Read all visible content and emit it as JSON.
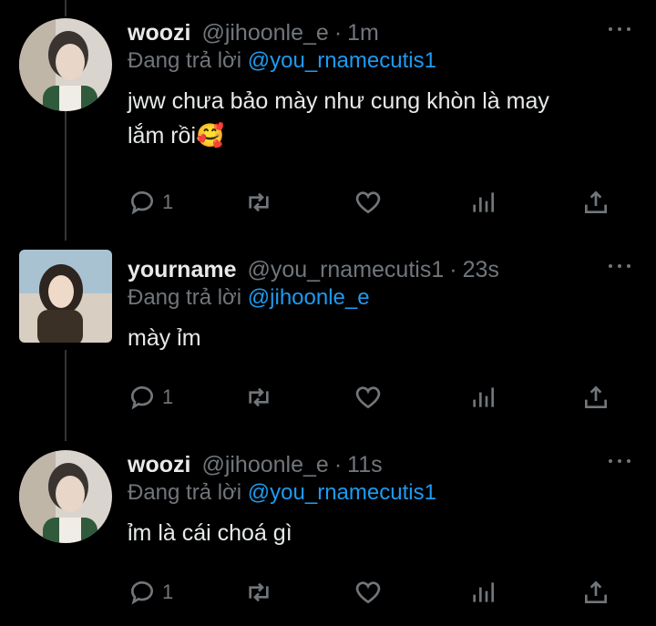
{
  "tweets": [
    {
      "name": "woozi",
      "handle": "@jihoonle_e",
      "dot": "·",
      "time": "1m",
      "reply_prefix": "Đang trả lời",
      "reply_to": "@you_rnamecutis1",
      "text_line1": "jww chưa bảo mày như cung khòn là may",
      "text_line2": "lắm rồi🥰",
      "reply_count": "1",
      "avatar_icon": "avatar-woozi"
    },
    {
      "name": "yourname",
      "handle": "@you_rnamecutis1",
      "dot": "·",
      "time": "23s",
      "reply_prefix": "Đang trả lời",
      "reply_to": "@jihoonle_e",
      "text_line1": "mày ỉm",
      "reply_count": "1",
      "avatar_icon": "avatar-yourname"
    },
    {
      "name": "woozi",
      "handle": "@jihoonle_e",
      "dot": "·",
      "time": "11s",
      "reply_prefix": "Đang trả lời",
      "reply_to": "@you_rnamecutis1",
      "text_line1": "ỉm là cái choá gì",
      "reply_count": "1",
      "avatar_icon": "avatar-woozi"
    }
  ],
  "icons": [
    "reply-icon",
    "retweet-icon",
    "like-icon",
    "views-icon",
    "share-icon",
    "more-icon"
  ],
  "colors": {
    "background": "#000000",
    "text": "#e7e9ea",
    "muted": "#71767b",
    "link": "#1d9bf0"
  }
}
